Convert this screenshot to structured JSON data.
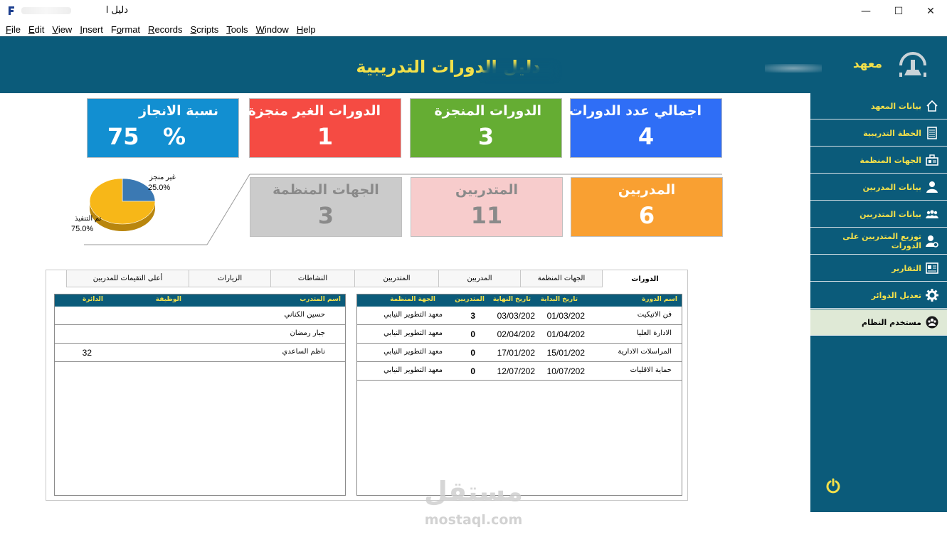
{
  "window": {
    "title": "دليل ا",
    "minimize": "—",
    "maximize": "☐",
    "close": "✕"
  },
  "menu": [
    {
      "label": "File",
      "u": "F",
      "rest": "ile"
    },
    {
      "label": "Edit",
      "u": "E",
      "rest": "dit"
    },
    {
      "label": "View",
      "u": "V",
      "rest": "iew"
    },
    {
      "label": "Insert",
      "u": "I",
      "rest": "nsert"
    },
    {
      "label": "Format",
      "pre": "F",
      "u": "o",
      "rest": "rmat"
    },
    {
      "label": "Records",
      "u": "R",
      "rest": "ecords"
    },
    {
      "label": "Scripts",
      "u": "S",
      "rest": "cripts"
    },
    {
      "label": "Tools",
      "u": "T",
      "rest": "ools"
    },
    {
      "label": "Window",
      "u": "W",
      "rest": "indow"
    },
    {
      "label": "Help",
      "u": "H",
      "rest": "elp"
    }
  ],
  "header": {
    "title": "دليل الدورات التدريبية",
    "institute": "معهد"
  },
  "sidebar": {
    "items": [
      {
        "label": "بيانات المعهد",
        "icon": "home-icon"
      },
      {
        "label": "الخطة التدريبية",
        "icon": "plan-icon"
      },
      {
        "label": "الجهات المنظمة",
        "icon": "organization-icon"
      },
      {
        "label": "بيانات المدربين",
        "icon": "user-icon"
      },
      {
        "label": "بيانات المتدربين",
        "icon": "group-icon"
      },
      {
        "label": "توزيع المتدربين على الدورات",
        "icon": "user-gear-icon"
      },
      {
        "label": "التقارير",
        "icon": "report-icon"
      },
      {
        "label": "تعديل الدوائر",
        "icon": "gear-icon"
      },
      {
        "label": "مستخدم النظام",
        "icon": "users-circle-icon",
        "active": true
      }
    ],
    "power_icon": "power-icon"
  },
  "tiles": [
    {
      "label": "اجمالي عدد الدورات",
      "value": "4",
      "color": "#2f6ef6"
    },
    {
      "label": "الدورات المنجزة",
      "value": "3",
      "color": "#65ad33"
    },
    {
      "label": "الدورات الغير منجزة",
      "value": "1",
      "color": "#f54b43"
    },
    {
      "label": "نسبة الانجاز",
      "value": "75   %",
      "color": "#128fd1"
    },
    {
      "label": "المدربين",
      "value": "6",
      "color": "#f9a032"
    },
    {
      "label": "المتدربين",
      "value": "11",
      "color": "#f7cccc"
    },
    {
      "label": "الجهات المنظمة",
      "value": "3",
      "color": "#cbcbcb"
    }
  ],
  "pie": {
    "label_top": "غير منجز",
    "pct_top": "25.0%",
    "label_bottom": "تم التنفيذ",
    "pct_bottom": "75.0%"
  },
  "chart_data": {
    "type": "pie",
    "categories": [
      "غير منجز",
      "تم التنفيذ"
    ],
    "values": [
      25.0,
      75.0
    ],
    "colors": [
      "#3b79b3",
      "#f7b718"
    ]
  },
  "tabs": [
    "الدورات",
    "الجهات المنظمة",
    "المدربين",
    "المتدربين",
    "النشاطات",
    "الزيارات",
    "أعلى التقيمات للمدربين"
  ],
  "courses": {
    "headers": {
      "name": "اسم الدورة",
      "start": "تاريخ البداية",
      "end": "تاريخ النهاية",
      "trainers": "المتدربين",
      "org": "الجهة المنظمة"
    },
    "rows": [
      {
        "name": "فن الاتيكيت",
        "start": "01/03/202",
        "end": "03/03/202",
        "trainers": "3",
        "org": "معهد التطوير النيابي"
      },
      {
        "name": "الادارة العليا",
        "start": "01/04/202",
        "end": "02/04/202",
        "trainers": "0",
        "org": "معهد التطوير النيابي"
      },
      {
        "name": "المراسلات الادارية",
        "start": "15/01/202",
        "end": "17/01/202",
        "trainers": "0",
        "org": "معهد التطوير النيابي"
      },
      {
        "name": "حماية الاقليات",
        "start": "10/07/202",
        "end": "12/07/202",
        "trainers": "0",
        "org": "معهد التطوير النيابي"
      }
    ]
  },
  "trainees": {
    "headers": {
      "name": "اسم المتدرب",
      "job": "الوظيفة",
      "dept": "الدائرة"
    },
    "rows": [
      {
        "name": "حسين الكناني",
        "job": "",
        "dept": ""
      },
      {
        "name": "جبار رمضان",
        "job": "",
        "dept": ""
      },
      {
        "name": "ناظم الساعدي",
        "job": "",
        "dept": "32"
      }
    ]
  },
  "watermark": {
    "text": "مستقل",
    "url": "mostaql.com"
  }
}
